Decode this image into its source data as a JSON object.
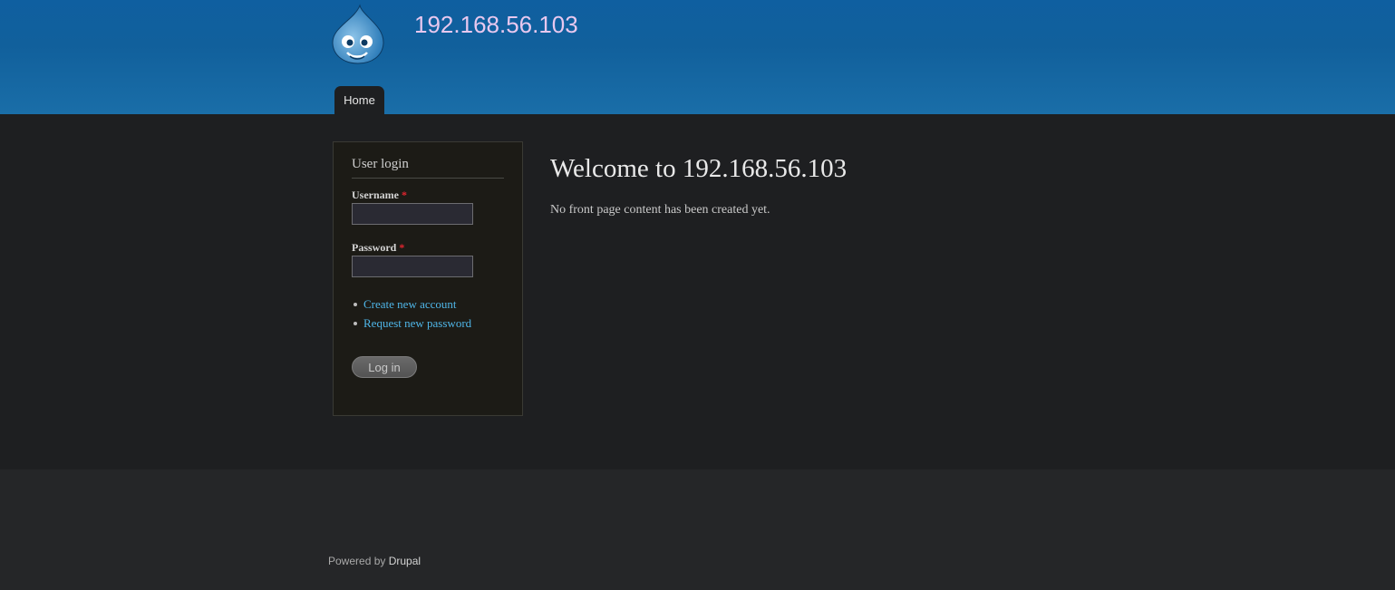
{
  "header": {
    "site_name": "192.168.56.103",
    "logo_icon": "drupal-drop-icon",
    "nav": [
      {
        "label": "Home"
      }
    ]
  },
  "login": {
    "title": "User login",
    "username_label": "Username",
    "password_label": "Password",
    "required_marker": "*",
    "username_value": "",
    "password_value": "",
    "links": [
      {
        "label": "Create new account"
      },
      {
        "label": "Request new password"
      }
    ],
    "submit_label": "Log in"
  },
  "content": {
    "title": "Welcome to 192.168.56.103",
    "text": "No front page content has been created yet."
  },
  "footer": {
    "powered_prefix": "Powered by ",
    "powered_link": "Drupal"
  },
  "colors": {
    "header_blue": "#11609c",
    "site_name": "#e8c8ef",
    "link": "#4fb6e8",
    "required": "#e0252f",
    "background": "#1e1f21"
  }
}
